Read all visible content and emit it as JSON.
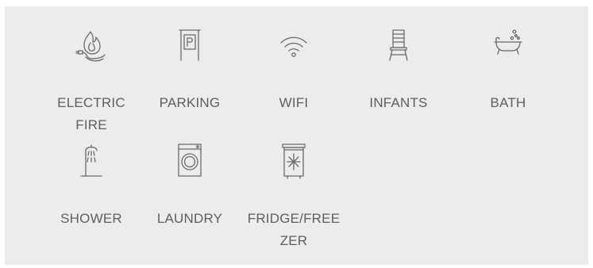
{
  "amenities": [
    {
      "label": "ELECTRIC\nFIRE",
      "icon": "electric-fire-icon"
    },
    {
      "label": "PARKING",
      "icon": "parking-icon"
    },
    {
      "label": "WIFI",
      "icon": "wifi-icon"
    },
    {
      "label": "INFANTS",
      "icon": "high-chair-icon"
    },
    {
      "label": "BATH",
      "icon": "bathtub-icon"
    },
    {
      "label": "SHOWER",
      "icon": "shower-icon"
    },
    {
      "label": "LAUNDRY",
      "icon": "washing-machine-icon"
    },
    {
      "label": "FRIDGE/FREE\nZER",
      "icon": "fridge-freezer-icon"
    }
  ],
  "colors": {
    "panel": "#ececec",
    "text": "#5e5e5e",
    "icon": "#6a6a6a"
  }
}
